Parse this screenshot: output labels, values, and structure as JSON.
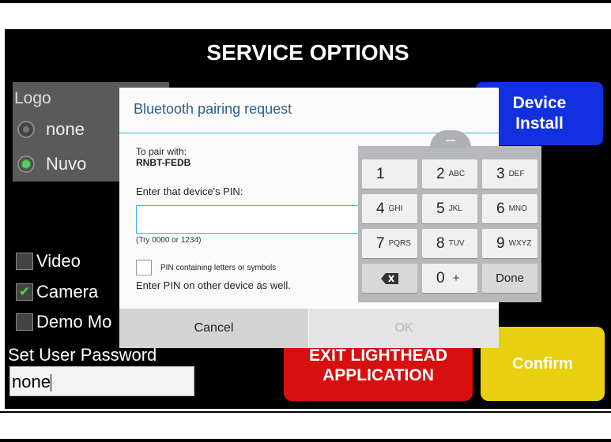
{
  "title": "SERVICE OPTIONS",
  "logo": {
    "label": "Logo",
    "options": [
      {
        "label": "none",
        "selected": false
      },
      {
        "label": "Nuvo",
        "selected": true
      }
    ]
  },
  "device_install": {
    "line1": "Device",
    "line2": "Install"
  },
  "checkboxes": [
    {
      "label": "Video",
      "checked": false
    },
    {
      "label": "Camera",
      "checked": true
    },
    {
      "label": "Demo Mo",
      "checked": false
    }
  ],
  "password": {
    "label": "Set User Password",
    "value": "none"
  },
  "exit_button": {
    "line1": "EXIT LIGHTHEAD",
    "line2": "APPLICATION"
  },
  "confirm_button": "Confirm",
  "dialog": {
    "title": "Bluetooth pairing request",
    "pair_with_label": "To pair with:",
    "device_name": "RNBT-FEDB",
    "enter_pin_label": "Enter that device's PIN:",
    "pin_value": "",
    "pin_hint": "(Try 0000 or 1234)",
    "alnum_label": "PIN containing letters or symbols",
    "enter_on_other": "Enter PIN on other device as well.",
    "cancel": "Cancel",
    "ok": "OK"
  },
  "keypad": {
    "keys": [
      {
        "num": "1",
        "letters": ""
      },
      {
        "num": "2",
        "letters": "ABC"
      },
      {
        "num": "3",
        "letters": "DEF"
      },
      {
        "num": "4",
        "letters": "GHI"
      },
      {
        "num": "5",
        "letters": "JKL"
      },
      {
        "num": "6",
        "letters": "MNO"
      },
      {
        "num": "7",
        "letters": "PQRS"
      },
      {
        "num": "8",
        "letters": "TUV"
      },
      {
        "num": "9",
        "letters": "WXYZ"
      }
    ],
    "backspace_icon": "backspace-icon",
    "zero": "0",
    "zero_alt": "+",
    "done": "Done"
  },
  "colors": {
    "device_install_bg": "#1230e0",
    "exit_bg": "#d80f0f",
    "confirm_bg": "#e8cf10",
    "dialog_title": "#2d5f8b",
    "accent_line": "#33b5e5",
    "radio_on": "#4fd35a"
  }
}
